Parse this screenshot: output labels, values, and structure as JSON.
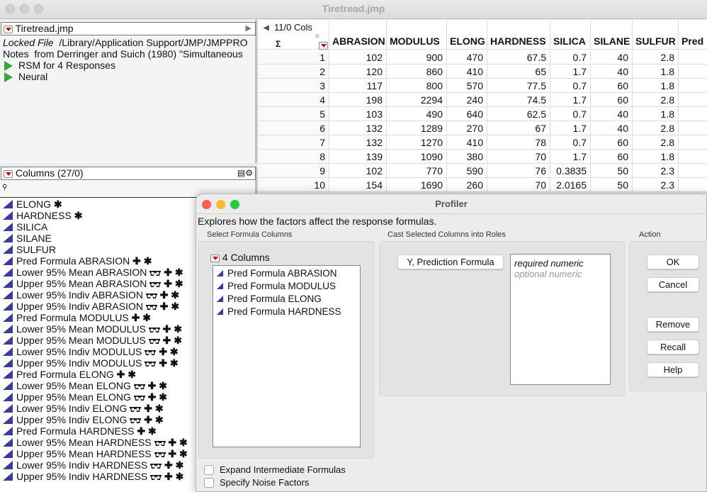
{
  "window": {
    "title": "Tiretread.jmp"
  },
  "table_panel": {
    "name": "Tiretread.jmp",
    "locked_label": "Locked File",
    "locked_path": "/Library/Application Support/JMP/JMPPRO",
    "notes_label": "Notes",
    "notes_text": "from Derringer and Suich (1980) \"Simultaneous",
    "scripts": [
      "RSM for 4 Responses",
      "Neural"
    ]
  },
  "grid": {
    "cols_label": "11/0 Cols",
    "sigma": "Σ",
    "columns": [
      "ABRASION",
      "MODULUS",
      "ELONG",
      "HARDNESS",
      "SILICA",
      "SILANE",
      "SULFUR",
      "Pred"
    ],
    "rows": [
      [
        "1",
        "102",
        "900",
        "470",
        "67.5",
        "0.7",
        "40",
        "2.8"
      ],
      [
        "2",
        "120",
        "860",
        "410",
        "65",
        "1.7",
        "40",
        "1.8"
      ],
      [
        "3",
        "117",
        "800",
        "570",
        "77.5",
        "0.7",
        "60",
        "1.8"
      ],
      [
        "4",
        "198",
        "2294",
        "240",
        "74.5",
        "1.7",
        "60",
        "2.8"
      ],
      [
        "5",
        "103",
        "490",
        "640",
        "62.5",
        "0.7",
        "40",
        "1.8"
      ],
      [
        "6",
        "132",
        "1289",
        "270",
        "67",
        "1.7",
        "40",
        "2.8"
      ],
      [
        "7",
        "132",
        "1270",
        "410",
        "78",
        "0.7",
        "60",
        "2.8"
      ],
      [
        "8",
        "139",
        "1090",
        "380",
        "70",
        "1.7",
        "60",
        "1.8"
      ],
      [
        "9",
        "102",
        "770",
        "590",
        "76",
        "0.3835",
        "50",
        "2.3"
      ],
      [
        "10",
        "154",
        "1690",
        "260",
        "70",
        "2.0165",
        "50",
        "2.3"
      ]
    ],
    "row_marker_color": "#f07a8a"
  },
  "columns_panel": {
    "title": "Columns (27/0)",
    "items": [
      {
        "label": "ELONG",
        "glasses": false,
        "plus": false,
        "star": true
      },
      {
        "label": "HARDNESS",
        "glasses": false,
        "plus": false,
        "star": true
      },
      {
        "label": "SILICA",
        "glasses": false,
        "plus": false,
        "star": false
      },
      {
        "label": "SILANE",
        "glasses": false,
        "plus": false,
        "star": false
      },
      {
        "label": "SULFUR",
        "glasses": false,
        "plus": false,
        "star": false
      },
      {
        "label": "Pred Formula ABRASION",
        "glasses": false,
        "plus": true,
        "star": true
      },
      {
        "label": "Lower 95% Mean ABRASION",
        "glasses": true,
        "plus": true,
        "star": true
      },
      {
        "label": "Upper 95% Mean ABRASION",
        "glasses": true,
        "plus": true,
        "star": true
      },
      {
        "label": "Lower 95% Indiv ABRASION",
        "glasses": true,
        "plus": true,
        "star": true
      },
      {
        "label": "Upper 95% Indiv ABRASION",
        "glasses": true,
        "plus": true,
        "star": true
      },
      {
        "label": "Pred Formula MODULUS",
        "glasses": false,
        "plus": true,
        "star": true
      },
      {
        "label": "Lower 95% Mean MODULUS",
        "glasses": true,
        "plus": true,
        "star": true
      },
      {
        "label": "Upper 95% Mean MODULUS",
        "glasses": true,
        "plus": true,
        "star": true
      },
      {
        "label": "Lower 95% Indiv MODULUS",
        "glasses": true,
        "plus": true,
        "star": true
      },
      {
        "label": "Upper 95% Indiv MODULUS",
        "glasses": true,
        "plus": true,
        "star": true
      },
      {
        "label": "Pred Formula ELONG",
        "glasses": false,
        "plus": true,
        "star": true
      },
      {
        "label": "Lower 95% Mean ELONG",
        "glasses": true,
        "plus": true,
        "star": true
      },
      {
        "label": "Upper 95% Mean ELONG",
        "glasses": true,
        "plus": true,
        "star": true
      },
      {
        "label": "Lower 95% Indiv ELONG",
        "glasses": true,
        "plus": true,
        "star": true
      },
      {
        "label": "Upper 95% Indiv ELONG",
        "glasses": true,
        "plus": true,
        "star": true
      },
      {
        "label": "Pred Formula HARDNESS",
        "glasses": false,
        "plus": true,
        "star": true
      },
      {
        "label": "Lower 95% Mean HARDNESS",
        "glasses": true,
        "plus": true,
        "star": true
      },
      {
        "label": "Upper 95% Mean HARDNESS",
        "glasses": true,
        "plus": true,
        "star": true
      },
      {
        "label": "Lower 95% Indiv HARDNESS",
        "glasses": true,
        "plus": true,
        "star": true
      },
      {
        "label": "Upper 95% Indiv HARDNESS",
        "glasses": true,
        "plus": true,
        "star": true
      }
    ]
  },
  "profiler": {
    "title": "Profiler",
    "description": "Explores how the factors affect the response formulas.",
    "select_label": "Select Formula Columns",
    "cast_label": "Cast Selected Columns into Roles",
    "action_label": "Action",
    "columns_count": "4 Columns",
    "formula_columns": [
      "Pred Formula ABRASION",
      "Pred Formula MODULUS",
      "Pred Formula ELONG",
      "Pred Formula HARDNESS"
    ],
    "role_button": "Y, Prediction Formula",
    "role_required": "required numeric",
    "role_optional": "optional numeric",
    "actions": {
      "ok": "OK",
      "cancel": "Cancel",
      "remove": "Remove",
      "recall": "Recall",
      "help": "Help"
    },
    "checkboxes": [
      {
        "label": "Expand Intermediate Formulas",
        "checked": false
      },
      {
        "label": "Specify Noise Factors",
        "checked": false
      }
    ]
  }
}
